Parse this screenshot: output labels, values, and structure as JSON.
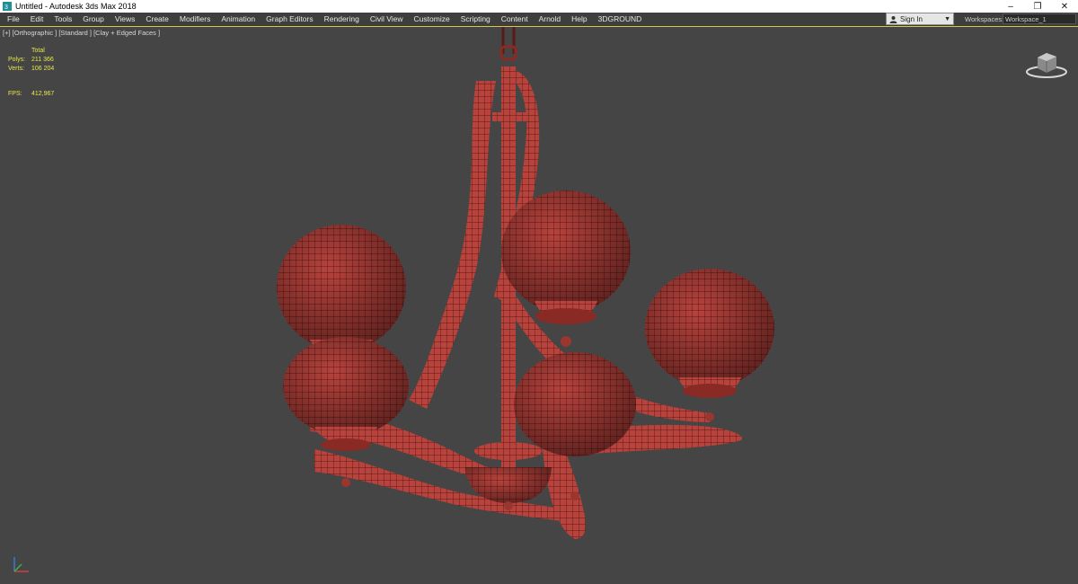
{
  "window": {
    "title": "Untitled - Autodesk 3ds Max 2018",
    "minimize": "–",
    "maximize": "❐",
    "close": "✕"
  },
  "menu": [
    "File",
    "Edit",
    "Tools",
    "Group",
    "Views",
    "Create",
    "Modifiers",
    "Animation",
    "Graph Editors",
    "Rendering",
    "Civil View",
    "Customize",
    "Scripting",
    "Content",
    "Arnold",
    "Help",
    "3DGROUND"
  ],
  "signin": {
    "label": "Sign In"
  },
  "workspace": {
    "label": "Workspaces:",
    "value": "Workspace_1"
  },
  "viewport": {
    "label": "[+] [Orthographic ] [Standard ] [Clay + Edged Faces ]",
    "stats": {
      "header": "Total",
      "polys_label": "Polys:",
      "polys_value": "211 366",
      "verts_label": "Verts:",
      "verts_value": "106 204",
      "fps_label": "FPS:",
      "fps_value": "412,967"
    }
  },
  "colors": {
    "model": "#b8423c",
    "wire": "#3a0f0d",
    "viewport_bg": "#454545",
    "stats_text": "#e8e84a"
  },
  "icons": [
    "3dsmax-app-icon",
    "user-icon",
    "chevron-down-icon",
    "viewcube-icon",
    "axis-tripod-icon"
  ]
}
